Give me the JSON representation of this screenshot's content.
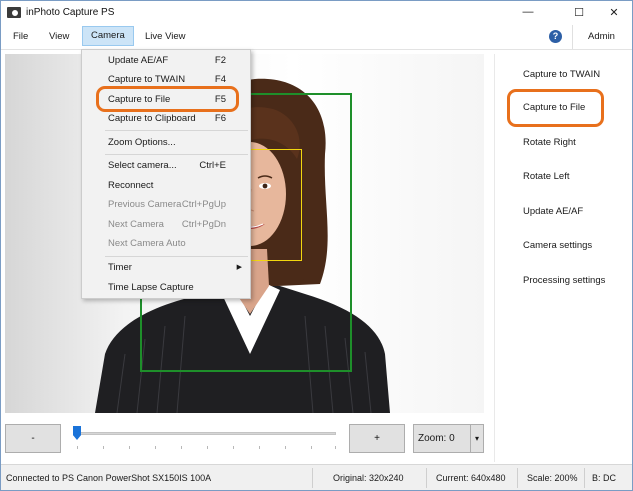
{
  "window": {
    "title": "inPhoto Capture PS",
    "controls": {
      "minimize": "—",
      "maximize": "☐",
      "close": "✕"
    }
  },
  "menubar": {
    "items": [
      {
        "label": "File"
      },
      {
        "label": "View"
      },
      {
        "label": "Camera"
      },
      {
        "label": "Live View"
      }
    ],
    "help_icon": "help-icon",
    "help_glyph": "?",
    "admin_label": "Admin"
  },
  "camera_menu": {
    "items": [
      {
        "label": "Update AE/AF",
        "shortcut": "F2",
        "enabled": true
      },
      {
        "label": "Capture to TWAIN",
        "shortcut": "F4",
        "enabled": true
      },
      {
        "label": "Capture to File",
        "shortcut": "F5",
        "enabled": true,
        "highlighted": true
      },
      {
        "label": "Capture to Clipboard",
        "shortcut": "F6",
        "enabled": true
      },
      {
        "label": "Zoom Options...",
        "shortcut": "",
        "enabled": true
      },
      {
        "label": "Select camera...",
        "shortcut": "Ctrl+E",
        "enabled": true
      },
      {
        "label": "Reconnect",
        "shortcut": "",
        "enabled": true
      },
      {
        "label": "Previous Camera",
        "shortcut": "Ctrl+PgUp",
        "enabled": false
      },
      {
        "label": "Next Camera",
        "shortcut": "Ctrl+PgDn",
        "enabled": false
      },
      {
        "label": "Next Camera Auto",
        "shortcut": "",
        "enabled": false
      },
      {
        "label": "Timer",
        "shortcut": "",
        "enabled": true,
        "submenu": true
      },
      {
        "label": "Time Lapse Capture",
        "shortcut": "",
        "enabled": true
      }
    ],
    "submenu_arrow": "▶"
  },
  "right_panel": {
    "buttons": [
      {
        "label": "Capture to TWAIN"
      },
      {
        "label": "Capture to File",
        "highlighted": true
      },
      {
        "label": "Rotate Right"
      },
      {
        "label": "Rotate Left"
      },
      {
        "label": "Update AE/AF"
      },
      {
        "label": "Camera settings"
      },
      {
        "label": "Processing settings"
      }
    ]
  },
  "controls": {
    "minus_label": "-",
    "plus_label": "+",
    "zoom_label": "Zoom: 0",
    "zoom_arrow": "▾",
    "zoom_slider_value": 0
  },
  "statusbar": {
    "connection": "Connected to PS Canon PowerShot SX150IS 100A",
    "original": "Original: 320x240",
    "current": "Current: 640x480",
    "scale": "Scale: 200%",
    "bdc": "B: DC"
  },
  "colors": {
    "highlight_ring": "#e8701c",
    "capture_frame": "#1e8f2a",
    "face_frame": "#f2d60f",
    "menu_open_bg": "#cce4f7"
  }
}
